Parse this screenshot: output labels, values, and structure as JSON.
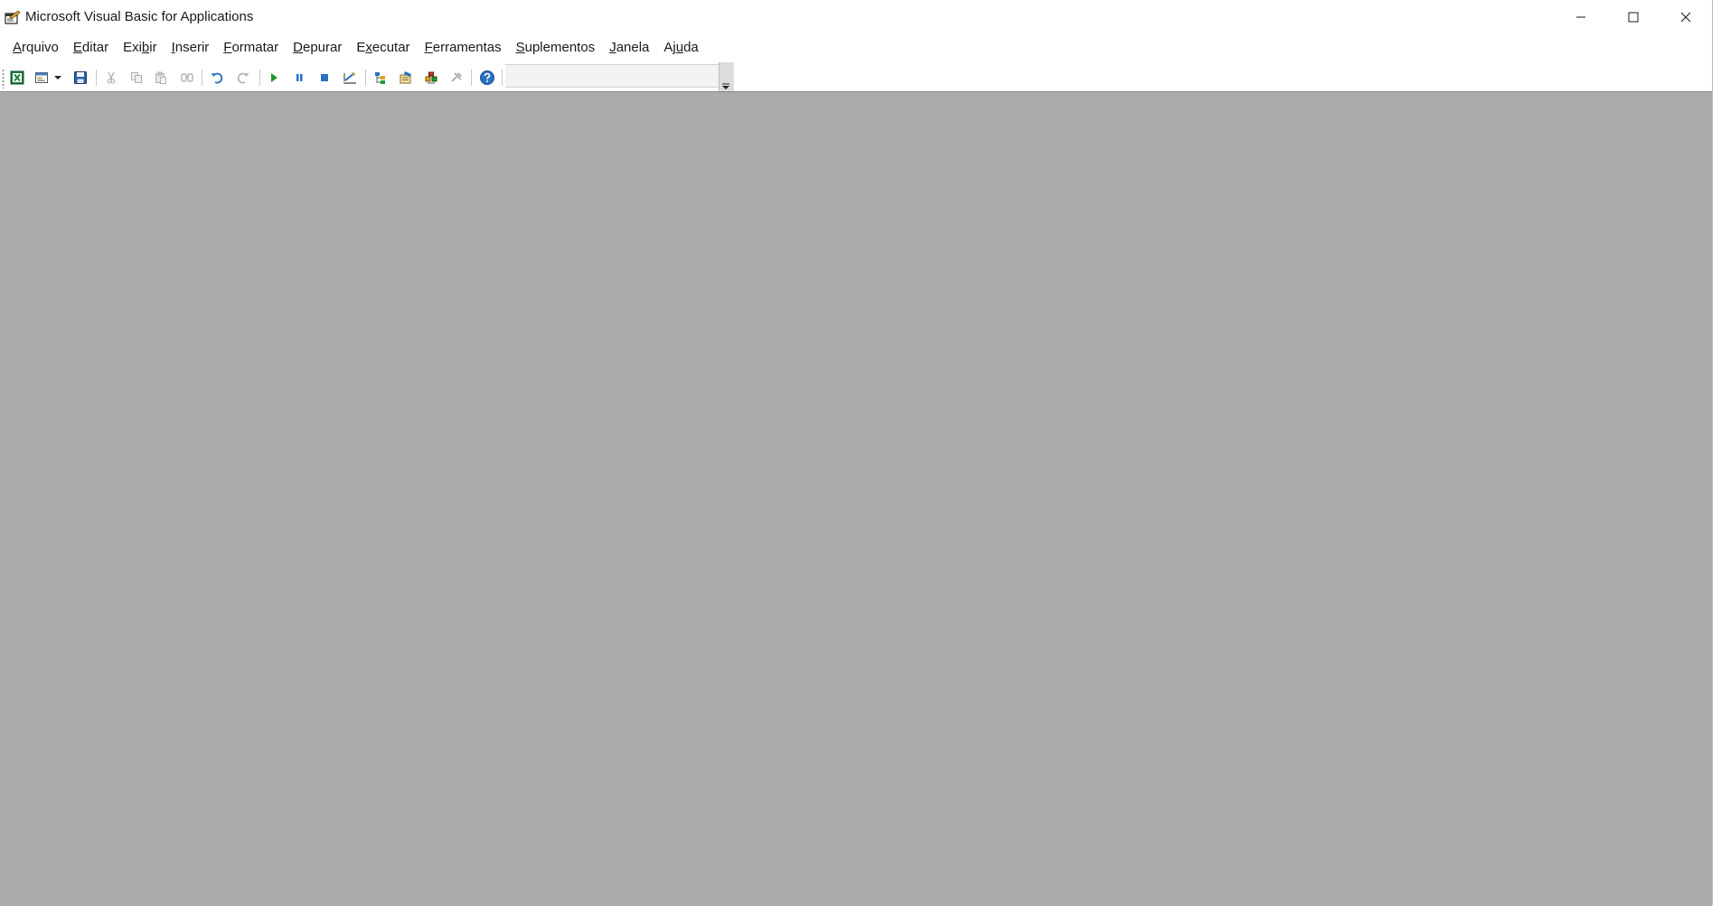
{
  "window": {
    "title": "Microsoft Visual Basic for Applications"
  },
  "menubar": {
    "items": [
      {
        "label": "Arquivo",
        "accent": "A",
        "rest": "rquivo"
      },
      {
        "label": "Editar",
        "accent": "E",
        "rest": "ditar"
      },
      {
        "label": "Exibir",
        "accent": "",
        "rest": ""
      },
      {
        "label": "Inserir",
        "accent": "I",
        "rest": "nserir"
      },
      {
        "label": "Formatar",
        "accent": "F",
        "rest": "ormatar"
      },
      {
        "label": "Depurar",
        "accent": "D",
        "rest": "epurar"
      },
      {
        "label": "Executar",
        "accent": "",
        "rest": ""
      },
      {
        "label": "Ferramentas",
        "accent": "F",
        "rest": "erramentas"
      },
      {
        "label": "Suplementos",
        "accent": "S",
        "rest": "uplementos"
      },
      {
        "label": "Janela",
        "accent": "J",
        "rest": "anela"
      },
      {
        "label": "Ajuda",
        "accent": "",
        "rest": ""
      }
    ]
  },
  "toolbar": {
    "buttons": [
      {
        "name": "view-excel",
        "icon": "excel-icon"
      },
      {
        "name": "insert-userform",
        "icon": "userform-icon"
      },
      {
        "name": "insert-dropdown",
        "icon": "chevron-down-icon"
      },
      {
        "name": "save",
        "icon": "save-icon"
      },
      {
        "name": "cut",
        "icon": "cut-icon"
      },
      {
        "name": "copy",
        "icon": "copy-icon"
      },
      {
        "name": "paste",
        "icon": "paste-icon"
      },
      {
        "name": "find",
        "icon": "find-icon"
      },
      {
        "name": "undo",
        "icon": "undo-icon"
      },
      {
        "name": "redo",
        "icon": "redo-icon"
      },
      {
        "name": "run",
        "icon": "run-icon"
      },
      {
        "name": "break",
        "icon": "pause-icon"
      },
      {
        "name": "reset",
        "icon": "stop-icon"
      },
      {
        "name": "design-mode",
        "icon": "design-mode-icon"
      },
      {
        "name": "project-explorer",
        "icon": "project-explorer-icon"
      },
      {
        "name": "properties-window",
        "icon": "properties-icon"
      },
      {
        "name": "object-browser",
        "icon": "object-browser-icon"
      },
      {
        "name": "toolbox",
        "icon": "toolbox-icon"
      },
      {
        "name": "help",
        "icon": "help-icon"
      }
    ],
    "position_text": ""
  },
  "colors": {
    "workspace": "#ababab",
    "accent_blue": "#2b6fc4",
    "run_green": "#1e9a2a"
  }
}
